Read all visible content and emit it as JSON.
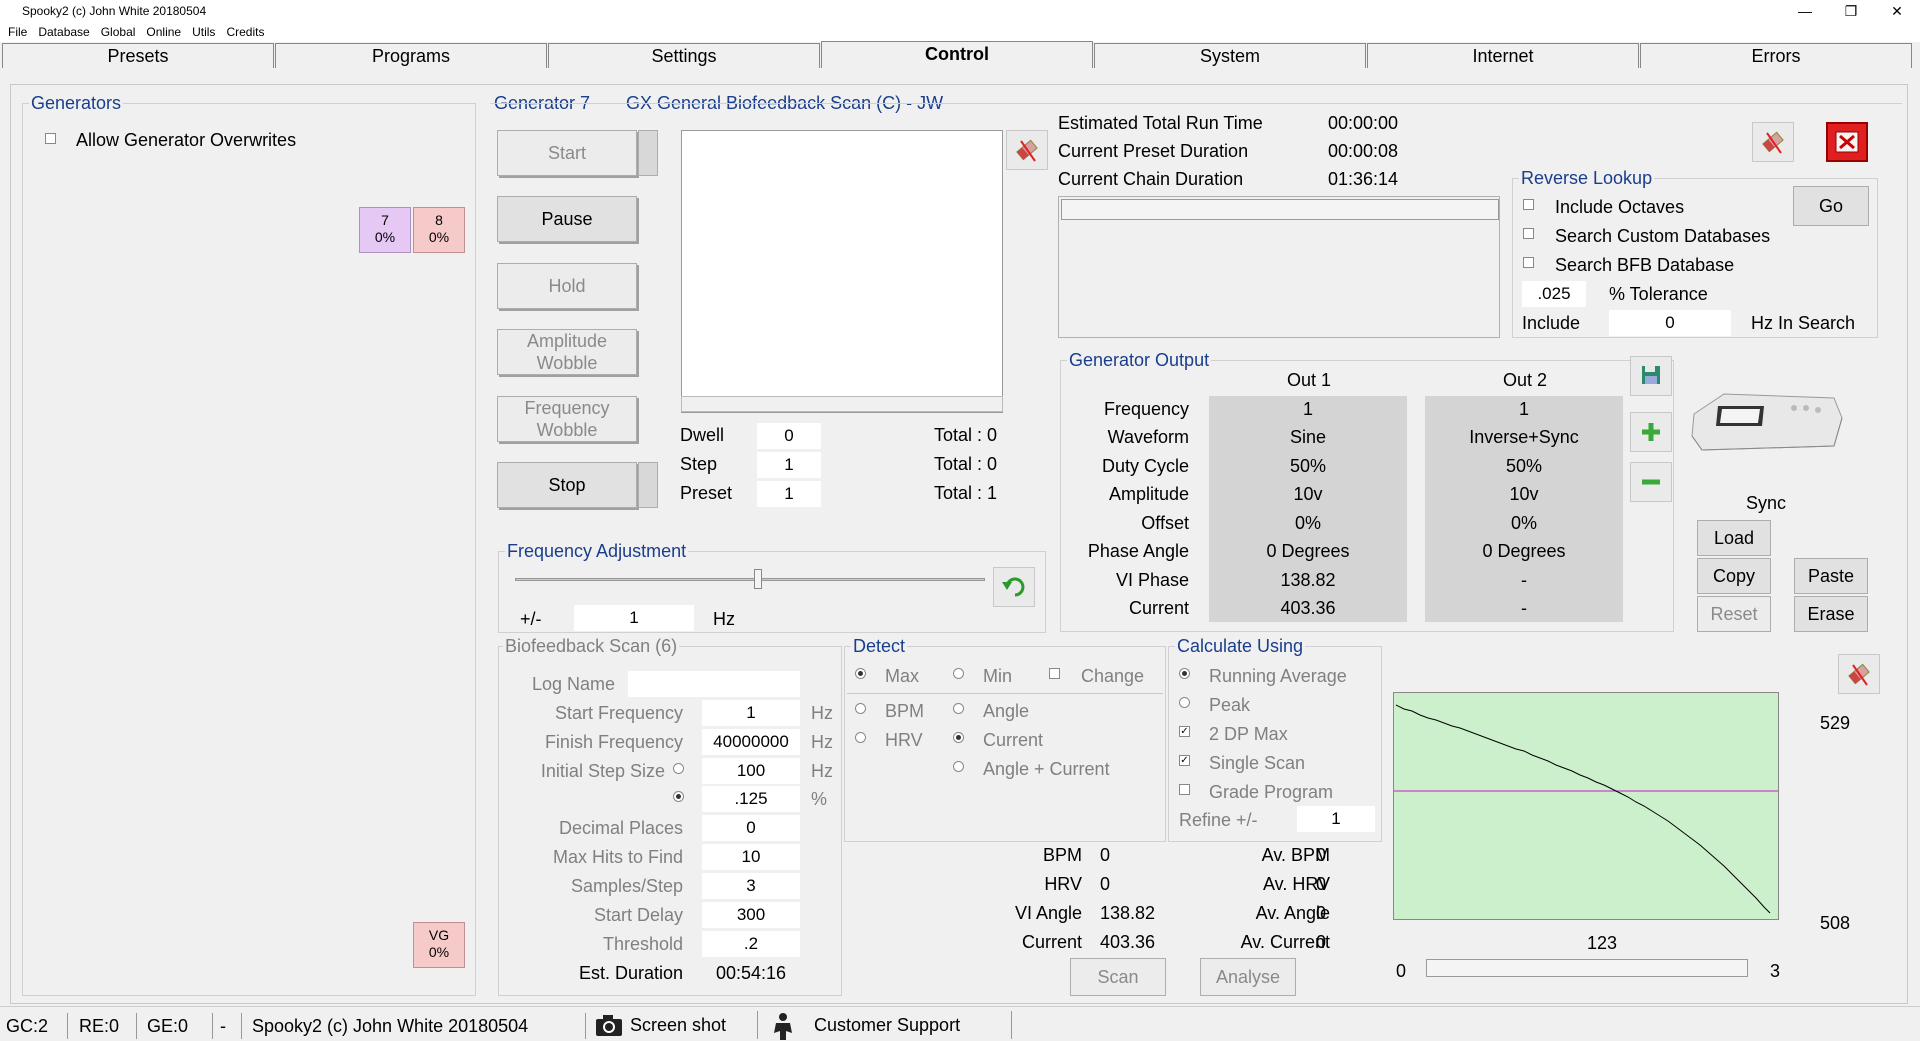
{
  "window": {
    "title": "Spooky2 (c) John White 20180504",
    "min": "—",
    "max": "❐",
    "close": "✕"
  },
  "menu": [
    "File",
    "Database",
    "Global",
    "Online",
    "Utils",
    "Credits"
  ],
  "tabs": [
    "Presets",
    "Programs",
    "Settings",
    "Control",
    "System",
    "Internet",
    "Errors"
  ],
  "generators": {
    "legend": "Generators",
    "allow_overwrites": "Allow Generator Overwrites",
    "tiles": [
      {
        "num": "7",
        "pct": "0%",
        "color": "#e6c8f5"
      },
      {
        "num": "8",
        "pct": "0%",
        "color": "#f7caca"
      }
    ],
    "vg": {
      "num": "VG",
      "pct": "0%",
      "color": "#f7caca"
    }
  },
  "generator": {
    "label": "Generator 7",
    "program": "GX General Biofeedback Scan (C) - JW",
    "buttons": {
      "start": "Start",
      "pause": "Pause",
      "hold": "Hold",
      "amp_wobble": "Amplitude Wobble",
      "freq_wobble": "Frequency Wobble",
      "stop": "Stop"
    }
  },
  "progress": {
    "dwell_label": "Dwell",
    "dwell": "0",
    "dwell_total": "Total : 0",
    "step_label": "Step",
    "step": "1",
    "step_total": "Total : 0",
    "preset_label": "Preset",
    "preset": "1",
    "preset_total": "Total : 1"
  },
  "runtime": {
    "est_total_label": "Estimated Total Run Time",
    "est_total": "00:00:00",
    "preset_dur_label": "Current Preset Duration",
    "preset_dur": "00:00:08",
    "chain_dur_label": "Current Chain Duration",
    "chain_dur": "01:36:14"
  },
  "reverse_lookup": {
    "legend": "Reverse Lookup",
    "include_octaves": "Include Octaves",
    "search_custom": "Search Custom Databases",
    "search_bfb": "Search BFB Database",
    "go": "Go",
    "tolerance_value": ".025",
    "tolerance_label": "% Tolerance",
    "include_label": "Include",
    "include_value": "0",
    "hz_in_search": "Hz In Search"
  },
  "freq_adjust": {
    "legend": "Frequency Adjustment",
    "pm": "+/-",
    "value": "1",
    "unit": "Hz",
    "slider_level": 0.5
  },
  "output": {
    "legend": "Generator Output",
    "out1": "Out 1",
    "out2": "Out 2",
    "rows": [
      {
        "label": "Frequency",
        "o1": "1",
        "o2": "1"
      },
      {
        "label": "Waveform",
        "o1": "Sine",
        "o2": "Inverse+Sync"
      },
      {
        "label": "Duty Cycle",
        "o1": "50%",
        "o2": "50%"
      },
      {
        "label": "Amplitude",
        "o1": "10v",
        "o2": "10v"
      },
      {
        "label": "Offset",
        "o1": "0%",
        "o2": "0%"
      },
      {
        "label": "Phase Angle",
        "o1": "0 Degrees",
        "o2": "0 Degrees"
      },
      {
        "label": "VI Phase",
        "o1": "138.82",
        "o2": "-"
      },
      {
        "label": "Current",
        "o1": "403.36",
        "o2": "-"
      }
    ],
    "sync": "Sync",
    "load": "Load",
    "copy": "Copy",
    "paste": "Paste",
    "reset": "Reset",
    "erase": "Erase"
  },
  "scan": {
    "legend": "Biofeedback Scan (6)",
    "log_name": "Log Name",
    "rows": [
      {
        "label": "Start Frequency",
        "value": "1",
        "unit": "Hz"
      },
      {
        "label": "Finish Frequency",
        "value": "40000000",
        "unit": "Hz"
      },
      {
        "label": "Initial Step Size",
        "value": "100",
        "unit": "Hz"
      },
      {
        "label": "",
        "value": ".125",
        "unit": "%"
      },
      {
        "label": "Decimal Places",
        "value": "0",
        "unit": ""
      },
      {
        "label": "Max Hits to Find",
        "value": "10",
        "unit": ""
      },
      {
        "label": "Samples/Step",
        "value": "3",
        "unit": ""
      },
      {
        "label": "Start Delay",
        "value": "300",
        "unit": ""
      },
      {
        "label": "Threshold",
        "value": ".2",
        "unit": ""
      }
    ],
    "est_label": "Est. Duration",
    "est_value": "00:54:16"
  },
  "detect": {
    "legend": "Detect",
    "max": "Max",
    "min": "Min",
    "change": "Change",
    "bpm": "BPM",
    "hrv": "HRV",
    "angle": "Angle",
    "current": "Current",
    "angle_current": "Angle + Current"
  },
  "calc": {
    "legend": "Calculate Using",
    "running_avg": "Running Average",
    "peak": "Peak",
    "dp_max": "2 DP Max",
    "single_scan": "Single Scan",
    "grade": "Grade Program",
    "refine_label": "Refine +/-",
    "refine_value": "1"
  },
  "readings": [
    {
      "label": "BPM",
      "value": "0",
      "avlabel": "Av. BPM",
      "avvalue": "0"
    },
    {
      "label": "HRV",
      "value": "0",
      "avlabel": "Av. HRV",
      "avvalue": "0"
    },
    {
      "label": "VI Angle",
      "value": "138.82",
      "avlabel": "Av. Angle",
      "avvalue": "0"
    },
    {
      "label": "Current",
      "value": "403.36",
      "avlabel": "Av. Current",
      "avvalue": "0"
    }
  ],
  "scan_buttons": {
    "scan": "Scan",
    "analyse": "Analyse"
  },
  "graph": {
    "ymax": "529",
    "ymin": "508",
    "xcenter": "123",
    "slider_min": "0",
    "slider_max": "3",
    "bg": "#ccf0cc",
    "line": "#cc44cc"
  },
  "status": {
    "gc": "GC:2",
    "re": "RE:0",
    "ge": "GE:0",
    "dash": "-",
    "title": "Spooky2 (c) John White 20180504",
    "screenshot": "Screen shot",
    "support": "Customer Support"
  }
}
